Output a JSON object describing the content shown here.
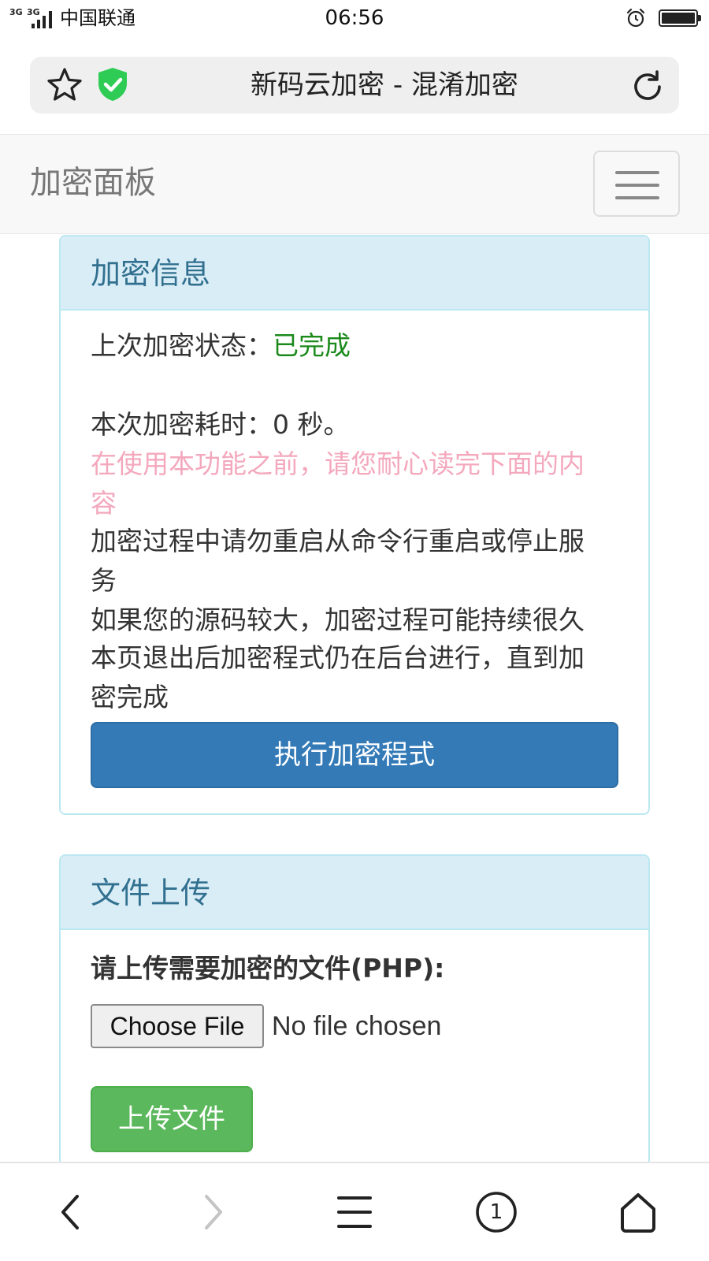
{
  "status_bar": {
    "network": "3G 3G",
    "carrier": "中国联通",
    "time": "06:56",
    "icons": [
      "signal-icon",
      "alarm-icon",
      "battery-icon"
    ]
  },
  "browser": {
    "title": "新码云加密 - 混淆加密",
    "icons": [
      "star-icon",
      "shield-icon",
      "reload-icon"
    ],
    "toolbar_icons": [
      "back-icon",
      "forward-icon",
      "menu-icon",
      "tabs-icon",
      "home-icon"
    ],
    "tab_count": "1"
  },
  "navbar": {
    "brand": "加密面板",
    "toggle_icon": "hamburger-icon"
  },
  "info_panel": {
    "title": "加密信息",
    "last_status_label": "上次加密状态：",
    "last_status_value": "已完成",
    "duration_text": "本次加密耗时：0 秒。",
    "warning_line1": "在使用本功能之前，请您耐心读完下面的内",
    "warning_line2": "容",
    "note1_line1": "加密过程中请勿重启从命令行重启或停止服",
    "note1_line2": "务",
    "note2": "如果您的源码较大，加密过程可能持续很久",
    "note3_line1": "本页退出后加密程式仍在后台进行，直到加",
    "note3_line2": "密完成",
    "run_button": "执行加密程式"
  },
  "upload_panel": {
    "title": "文件上传",
    "label": "请上传需要加密的文件(PHP):",
    "choose_button": "Choose File",
    "no_file_text": "No file chosen",
    "upload_button": "上传文件"
  },
  "colors": {
    "primary": "#337ab7",
    "success": "#5cb85c",
    "info_heading_bg": "#d9edf7",
    "info_heading_text": "#31708f",
    "done_green": "#1b8a1b",
    "warning_pink": "#f4a8bd",
    "shield_green": "#2ecc55"
  }
}
